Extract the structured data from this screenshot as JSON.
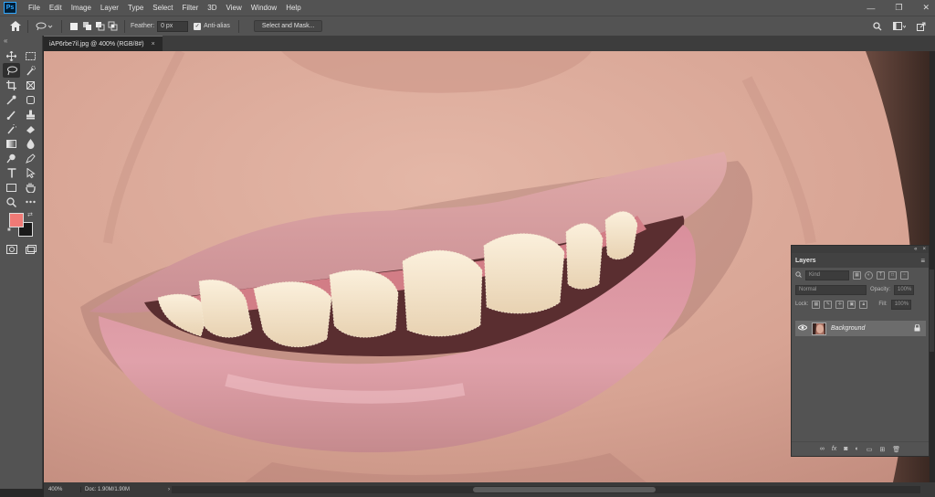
{
  "app": {
    "logo": "Ps"
  },
  "menu": [
    "File",
    "Edit",
    "Image",
    "Layer",
    "Type",
    "Select",
    "Filter",
    "3D",
    "View",
    "Window",
    "Help"
  ],
  "window_controls": {
    "minimize": "—",
    "maximize": "❐",
    "close": "✕"
  },
  "options": {
    "feather_label": "Feather:",
    "feather_value": "0 px",
    "antialias_label": "Anti-alias",
    "select_mask_label": "Select and Mask..."
  },
  "document": {
    "tab_title": "iAP6rbe7il.jpg @ 400% (RGB/8#)",
    "tab_close": "×"
  },
  "colors": {
    "foreground": "#f07a76",
    "background": "#1a1a1a"
  },
  "status": {
    "zoom": "400%",
    "doc_info": "Doc: 1.90M/1.90M",
    "arrow": "›"
  },
  "layers": {
    "tab": "Layers",
    "kind_placeholder": "Kind",
    "blend_mode": "Normal",
    "opacity_label": "Opacity:",
    "opacity_value": "100%",
    "lock_label": "Lock:",
    "fill_label": "Fill:",
    "fill_value": "100%",
    "layer_name": "Background"
  }
}
